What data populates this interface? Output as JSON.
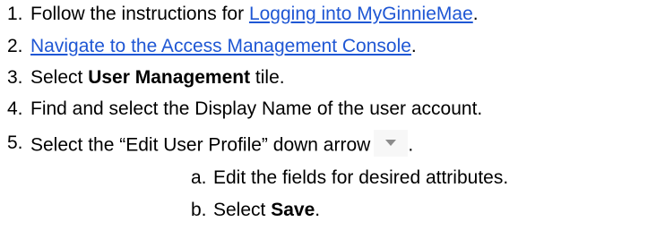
{
  "steps": [
    {
      "num": "1.",
      "pre": "Follow the instructions for ",
      "link": "Logging into MyGinnieMae",
      "post": "."
    },
    {
      "num": "2.",
      "link": "Navigate to the Access Management Console",
      "post": "."
    },
    {
      "num": "3.",
      "pre": "Select ",
      "bold": "User Management",
      "post": " tile."
    },
    {
      "num": "4.",
      "text": "Find and select the Display Name of the user account."
    },
    {
      "num": "5.",
      "pre": "Select the “Edit User Profile” down arrow",
      "post": "."
    }
  ],
  "substeps": [
    {
      "num": "a.",
      "text": "Edit the fields for desired attributes."
    },
    {
      "num": "b.",
      "pre": "Select ",
      "bold": "Save",
      "post": "."
    }
  ],
  "icons": {
    "dropdown_arrow": "chevron-down-icon"
  },
  "colors": {
    "link": "#1f57d4",
    "arrow_button_bg": "#f7f7f7",
    "arrow": "#8c8c8c"
  }
}
